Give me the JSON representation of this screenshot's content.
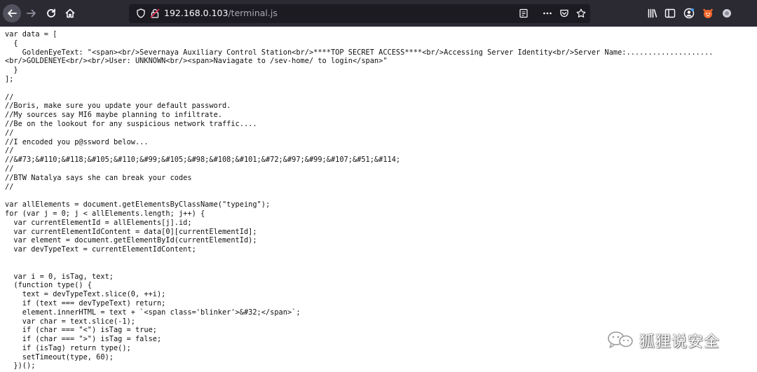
{
  "browser": {
    "url_host": "192.168.0.103",
    "url_path": "/terminal.js",
    "icons": [
      "back-arrow-icon",
      "forward-arrow-icon",
      "reload-icon",
      "home-icon",
      "shield-icon",
      "insecure-lock-icon",
      "reader-view-icon",
      "more-actions-icon",
      "pocket-icon",
      "bookmark-star-icon",
      "library-icon",
      "sidebar-icon",
      "account-icon",
      "extension-fox-icon",
      "extension-gray-icon"
    ]
  },
  "code_lines": [
    "var data = [",
    "  {",
    "    GoldenEyeText: \"<span><br/>Severnaya Auxiliary Control Station<br/>****TOP SECRET ACCESS****<br/>Accessing Server Identity<br/>Server Name:....................",
    "<br/>GOLDENEYE<br/><br/>User: UNKNOWN<br/><span>Naviagate to /sev-home/ to login</span>\"",
    "  }",
    "];",
    "",
    "//",
    "//Boris, make sure you update your default password.",
    "//My sources say MI6 maybe planning to infiltrate.",
    "//Be on the lookout for any suspicious network traffic....",
    "//",
    "//I encoded you p@ssword below...",
    "//",
    "//&#73;&#110;&#118;&#105;&#110;&#99;&#105;&#98;&#108;&#101;&#72;&#97;&#99;&#107;&#51;&#114;",
    "//",
    "//BTW Natalya says she can break your codes",
    "//",
    "",
    "var allElements = document.getElementsByClassName(\"typeing\");",
    "for (var j = 0; j < allElements.length; j++) {",
    "  var currentElementId = allElements[j].id;",
    "  var currentElementIdContent = data[0][currentElementId];",
    "  var element = document.getElementById(currentElementId);",
    "  var devTypeText = currentElementIdContent;",
    "",
    "",
    "  var i = 0, isTag, text;",
    "  (function type() {",
    "    text = devTypeText.slice(0, ++i);",
    "    if (text === devTypeText) return;",
    "    element.innerHTML = text + `<span class='blinker'>&#32;</span>`;",
    "    var char = text.slice(-1);",
    "    if (char === \"<\") isTag = true;",
    "    if (char === \">\") isTag = false;",
    "    if (isTag) return type();",
    "    setTimeout(type, 60);",
    "  })();"
  ],
  "watermark": {
    "text": "狐狸说安全",
    "icon": "wechat-icon"
  },
  "colors": {
    "toolbar": "#2b2a33",
    "urlbar": "#1c1b22",
    "page_bg": "#ffffff",
    "code_text": "#111111",
    "insecure_red": "#e22850"
  }
}
